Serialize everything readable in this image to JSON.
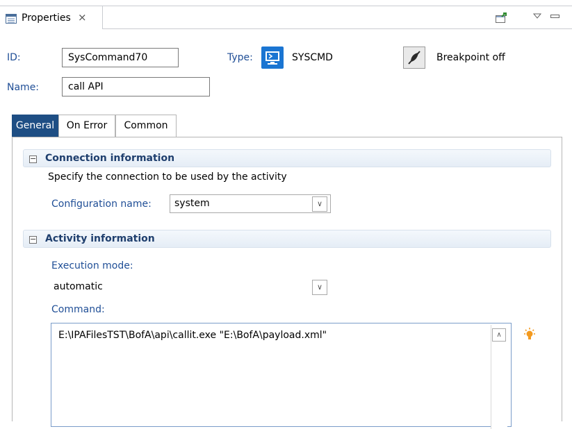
{
  "view": {
    "tab_label": "Properties",
    "close_glyph": "⨯",
    "toolbar_icons": [
      "pin-icon",
      "view-menu-icon",
      "minimize-icon"
    ]
  },
  "header": {
    "id_label": "ID:",
    "id_value": "SysCommand70",
    "type_label": "Type:",
    "type_value": "SYSCMD",
    "name_label": "Name:",
    "name_value": "call API",
    "breakpoint_label": "Breakpoint off"
  },
  "tabs": [
    {
      "label": "General",
      "active": true
    },
    {
      "label": "On Error",
      "active": false
    },
    {
      "label": "Common",
      "active": false
    }
  ],
  "connection": {
    "title": "Connection information",
    "description": "Specify the connection to be used by the activity",
    "config_label": "Configuration name:",
    "config_value": "system"
  },
  "activity": {
    "title": "Activity information",
    "exec_mode_label": "Execution mode:",
    "exec_mode_value": "automatic",
    "command_label": "Command:",
    "command_value": "E:\\IPAFilesTST\\BofA\\api\\callit.exe \"E:\\BofA\\payload.xml\""
  },
  "colors": {
    "accent": "#1e4e84",
    "label_blue": "#1f4e96",
    "lightbulb": "#f39a1f"
  }
}
